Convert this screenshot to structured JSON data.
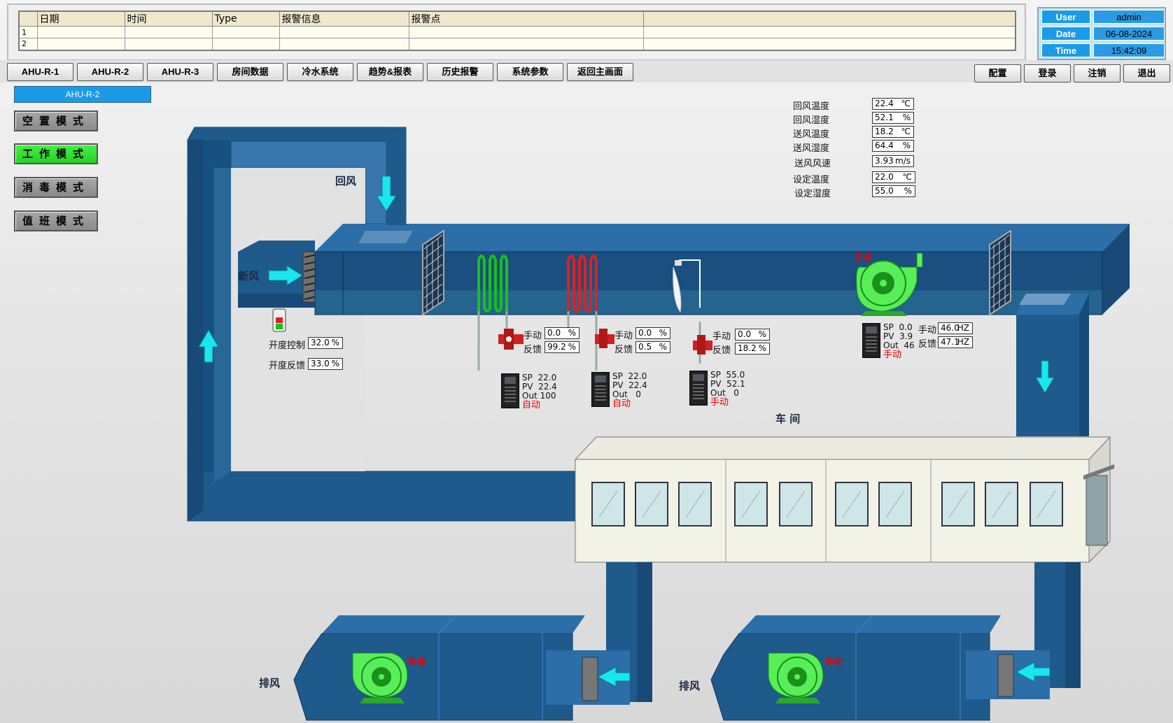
{
  "alarm": {
    "headers": [
      "日期",
      "时间",
      "Type",
      "报警信息",
      "报警点",
      ""
    ],
    "rows": [
      {
        "index": "1",
        "cells": [
          "",
          "",
          "",
          "",
          "",
          ""
        ]
      },
      {
        "index": "2",
        "cells": [
          "",
          "",
          "",
          "",
          "",
          ""
        ]
      }
    ]
  },
  "user_info": {
    "user_label": "User",
    "user_value": "admin",
    "date_label": "Date",
    "date_value": "06-08-2024",
    "time_label": "Time",
    "time_value": "15:42:09"
  },
  "nav": {
    "left": [
      "AHU-R-1",
      "AHU-R-2",
      "AHU-R-3",
      "房间数据",
      "冷水系统",
      "趋势&报表",
      "历史报警",
      "系统参数",
      "返回主画面"
    ],
    "right": [
      "配置",
      "登录",
      "注销",
      "退出"
    ]
  },
  "current_unit": "AHU-R-2",
  "modes": [
    {
      "label": "空置模式",
      "active": false
    },
    {
      "label": "工作模式",
      "active": true
    },
    {
      "label": "消毒模式",
      "active": false
    },
    {
      "label": "值班模式",
      "active": false
    }
  ],
  "readings": [
    {
      "label": "回风温度",
      "value": "22.4",
      "unit": "℃"
    },
    {
      "label": "回风湿度",
      "value": "52.1",
      "unit": "%"
    },
    {
      "label": "送风温度",
      "value": "18.2",
      "unit": "℃"
    },
    {
      "label": "送风湿度",
      "value": "64.4",
      "unit": "%"
    },
    {
      "label": "送风风速",
      "value": "3.93",
      "unit": "m/s"
    },
    {
      "label": "设定温度",
      "value": "22.0",
      "unit": "℃"
    },
    {
      "label": "设定湿度",
      "value": "55.0",
      "unit": "%"
    }
  ],
  "labels": {
    "return_air": "回风",
    "fresh_air": "新风",
    "exhaust1": "排风",
    "exhaust2": "排风",
    "workshop": "车   间",
    "manual": "手动",
    "feedback": "反馈",
    "auto": "自动",
    "damper_control": "开度控制",
    "damper_feedback": "开度反馈"
  },
  "damper": {
    "control": "32.0",
    "feedback": "33.0",
    "unit": "%"
  },
  "valves": [
    {
      "manual": "0.0",
      "feedback": "99.2",
      "unit": "%",
      "sp": "22.0",
      "pv": "22.4",
      "out": "100",
      "mode": "自动"
    },
    {
      "manual": "0.0",
      "feedback": "0.5",
      "unit": "%",
      "sp": "22.0",
      "pv": "22.4",
      "out": "0",
      "mode": "自动"
    },
    {
      "manual": "0.0",
      "feedback": "18.2",
      "unit": "%",
      "sp": "55.0",
      "pv": "52.1",
      "out": "0",
      "mode": "手动"
    }
  ],
  "supply_fan": {
    "status": "手动",
    "sp": "0.0",
    "pv": "3.9",
    "out": "46",
    "manual": "46.0",
    "feedback": "47.1",
    "unit": "HZ",
    "mode": "手动"
  },
  "exhaust_fans": [
    {
      "status": "手动"
    },
    {
      "status": "手动"
    }
  ],
  "pid_labels": {
    "sp": "SP",
    "pv": "PV",
    "out": "Out"
  },
  "colors": {
    "duct": "#1f5a8c",
    "duct_dark": "#174a76",
    "duct_light": "#2b6ea8",
    "arrow": "#19e6f0",
    "fan": "#58ee58",
    "heat_coil": "#e02020",
    "cool_coil": "#19c019",
    "accent_blue": "#1a9be8"
  }
}
